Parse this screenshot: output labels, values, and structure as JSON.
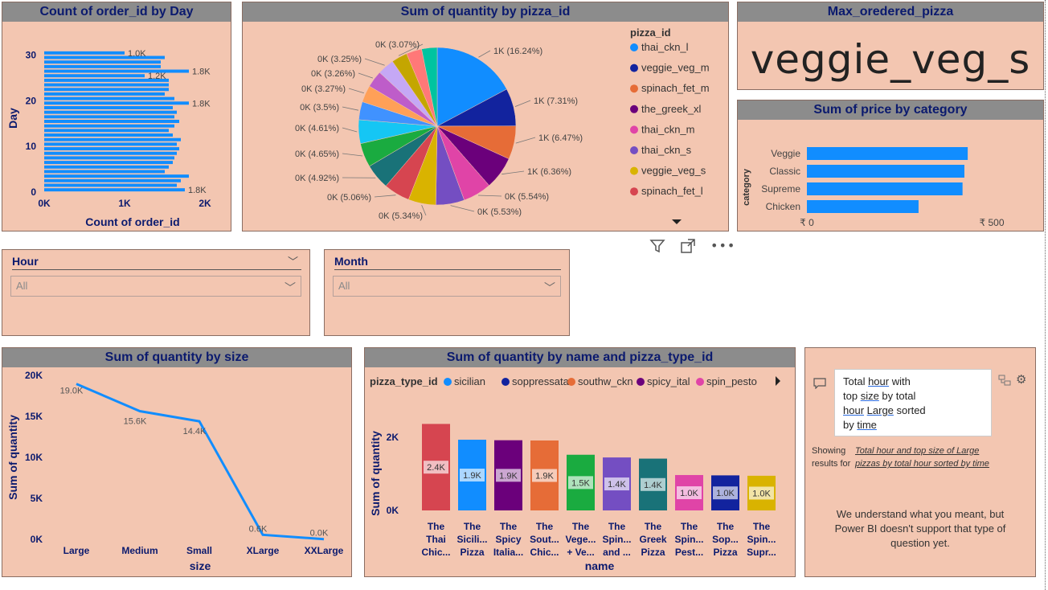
{
  "colors": {
    "panel_bg": "#f3c6b1",
    "title_bar": "#8c8c8c",
    "title_text": "#0b1a6e",
    "bar_blue": "#118dff"
  },
  "day_chart": {
    "title": "Count of order_id by Day",
    "chart_data": {
      "type": "bar",
      "orientation": "horizontal",
      "title": "Count of order_id by Day",
      "xlabel": "Count of order_id",
      "ylabel": "Day",
      "x_ticks": [
        "0K",
        "1K",
        "2K"
      ],
      "y_ticks": [
        "0",
        "10",
        "20",
        "30"
      ],
      "xlim": [
        0,
        2000
      ],
      "ylim": [
        0,
        31
      ],
      "categories": [
        1,
        2,
        3,
        4,
        5,
        6,
        7,
        8,
        9,
        10,
        11,
        12,
        13,
        14,
        15,
        16,
        17,
        18,
        19,
        20,
        21,
        22,
        23,
        24,
        25,
        26,
        27,
        28,
        29,
        30,
        31
      ],
      "values": [
        1750,
        1650,
        1700,
        1800,
        1500,
        1550,
        1600,
        1620,
        1650,
        1680,
        1650,
        1700,
        1600,
        1550,
        1620,
        1680,
        1620,
        1650,
        1600,
        1800,
        1620,
        1500,
        1550,
        1550,
        1550,
        1250,
        1800,
        1450,
        1450,
        1500,
        1000
      ],
      "data_labels": [
        {
          "day": 1,
          "text": "1.8K"
        },
        {
          "day": 20,
          "text": "1.8K"
        },
        {
          "day": 26,
          "text": "1.2K"
        },
        {
          "day": 27,
          "text": "1.8K"
        },
        {
          "day": 31,
          "text": "1.0K"
        }
      ]
    }
  },
  "pie_chart": {
    "title": "Sum of quantity by pizza_id",
    "legend_title": "pizza_id",
    "legend": [
      "thai_ckn_l",
      "veggie_veg_m",
      "spinach_fet_m",
      "the_greek_xl",
      "thai_ckn_m",
      "thai_ckn_s",
      "veggie_veg_s",
      "spinach_fet_l"
    ],
    "chart_data": {
      "type": "pie",
      "title": "Sum of quantity by pizza_id",
      "legend_placement": "right",
      "slices": [
        {
          "name": "thai_ckn_l",
          "value": 16.24,
          "label": "1K (16.24%)",
          "color": "#118dff"
        },
        {
          "name": "veggie_veg_m",
          "value": 7.31,
          "label": "1K (7.31%)",
          "color": "#12239e"
        },
        {
          "name": "spinach_fet_m",
          "value": 6.47,
          "label": "1K (6.47%)",
          "color": "#e66c37"
        },
        {
          "name": "the_greek_xl",
          "value": 6.36,
          "label": "1K (6.36%)",
          "color": "#6b007b"
        },
        {
          "name": "thai_ckn_m",
          "value": 5.54,
          "label": "0K (5.54%)",
          "color": "#e044a7"
        },
        {
          "name": "thai_ckn_s",
          "value": 5.53,
          "label": "0K (5.53%)",
          "color": "#744ec2"
        },
        {
          "name": "veggie_veg_s",
          "value": 5.34,
          "label": "0K (5.34%)",
          "color": "#d9b300"
        },
        {
          "name": "spinach_fet_l",
          "value": 5.06,
          "label": "0K (5.06%)",
          "color": "#d64550"
        },
        {
          "name": "",
          "value": 4.92,
          "label": "0K (4.92%)",
          "color": "#197278"
        },
        {
          "name": "",
          "value": 4.65,
          "label": "0K (4.65%)",
          "color": "#1aab40"
        },
        {
          "name": "",
          "value": 4.61,
          "label": "0K (4.61%)",
          "color": "#15c6f4"
        },
        {
          "name": "",
          "value": 3.5,
          "label": "0K (3.5%)",
          "color": "#4092ff"
        },
        {
          "name": "",
          "value": 3.27,
          "label": "0K (3.27%)",
          "color": "#ffa058"
        },
        {
          "name": "",
          "value": 3.26,
          "label": "0K (3.26%)",
          "color": "#be5dc9"
        },
        {
          "name": "",
          "value": 3.25,
          "label": "0K (3.25%)",
          "color": "#c5a8f5"
        },
        {
          "name": "",
          "value": 3.07,
          "label": "0K (3.07%)",
          "color": "#c4a600"
        },
        {
          "name": "",
          "value": 3.0,
          "label": "",
          "color": "#ff7878"
        },
        {
          "name": "",
          "value": 3.0,
          "label": "",
          "color": "#00c4a0"
        }
      ]
    }
  },
  "card": {
    "title": "Max_oredered_pizza",
    "value": "veggie_veg_s"
  },
  "category_chart": {
    "title": "Sum of price by category",
    "chart_data": {
      "type": "bar",
      "orientation": "horizontal",
      "title": "Sum of price by category",
      "ylabel": "category",
      "xlabel": "",
      "x_ticks": [
        "₹ 0",
        "₹ 500"
      ],
      "xlim": [
        0,
        600
      ],
      "categories": [
        "Veggie",
        "Classic",
        "Supreme",
        "Chicken"
      ],
      "values": [
        435,
        426,
        421,
        302
      ]
    }
  },
  "toolbar": {
    "filter_icon": "filter-icon",
    "focus_icon": "focus-mode-icon",
    "more_icon": "more-options-icon"
  },
  "slicer_hour": {
    "title": "Hour",
    "value": "All"
  },
  "slicer_month": {
    "title": "Month",
    "value": "All"
  },
  "size_chart": {
    "title": "Sum of quantity by size",
    "chart_data": {
      "type": "line",
      "title": "Sum of quantity by size",
      "xlabel": "size",
      "ylabel": "Sum of quantity",
      "ylim": [
        0,
        20000
      ],
      "y_ticks": [
        "0K",
        "5K",
        "10K",
        "15K",
        "20K"
      ],
      "categories": [
        "Large",
        "Medium",
        "Small",
        "XLarge",
        "XXLarge"
      ],
      "values": [
        18956,
        15635,
        14403,
        552,
        28
      ],
      "data_labels": [
        "19.0K",
        "15.6K",
        "14.4K",
        "0.6K",
        "0.0K"
      ]
    }
  },
  "name_chart": {
    "title": "Sum of quantity by name and pizza_type_id",
    "legend_title": "pizza_type_id",
    "legend": [
      {
        "name": "sicilian",
        "color": "#118dff"
      },
      {
        "name": "soppressata",
        "color": "#12239e"
      },
      {
        "name": "southw_ckn",
        "color": "#e66c37"
      },
      {
        "name": "spicy_ital",
        "color": "#6b007b"
      },
      {
        "name": "spin_pesto",
        "color": "#e044a7"
      }
    ],
    "chart_data": {
      "type": "bar",
      "title": "Sum of quantity by name and pizza_type_id",
      "xlabel": "name",
      "ylabel": "Sum of quantity",
      "ylim": [
        0,
        2600
      ],
      "y_ticks": [
        "0K",
        "2K"
      ],
      "categories": [
        [
          "The",
          "Thai",
          "Chic..."
        ],
        [
          "The",
          "Sicili...",
          "Pizza"
        ],
        [
          "The",
          "Spicy",
          "Italia..."
        ],
        [
          "The",
          "Sout...",
          "Chic..."
        ],
        [
          "The",
          "Vege...",
          "+ Ve..."
        ],
        [
          "The",
          "Spin...",
          "and ..."
        ],
        [
          "The",
          "Greek",
          "Pizza"
        ],
        [
          "The",
          "Spin...",
          "Pest..."
        ],
        [
          "The",
          "Sop...",
          "Pizza"
        ],
        [
          "The",
          "Spin...",
          "Supr..."
        ]
      ],
      "values": [
        2371,
        1938,
        1924,
        1917,
        1526,
        1452,
        1420,
        970,
        961,
        950
      ],
      "data_labels": [
        "2.4K",
        "1.9K",
        "1.9K",
        "1.9K",
        "1.5K",
        "1.4K",
        "1.4K",
        "1.0K",
        "1.0K",
        "1.0K"
      ],
      "colors": [
        "#d64550",
        "#118dff",
        "#6b007b",
        "#e66c37",
        "#1aab40",
        "#744ec2",
        "#197278",
        "#e044a7",
        "#12239e",
        "#d9b300"
      ]
    }
  },
  "qa": {
    "question_html_parts": [
      "Total ",
      "hour",
      " with",
      "top ",
      "size",
      " by total",
      "hour",
      " ",
      "Large",
      " sorted",
      "by ",
      "time"
    ],
    "showing_label": "Showing results for",
    "showing_link": "Total hour and top size of Large pizzas by total hour sorted by time",
    "message": "We understand what you meant, but Power BI doesn't support that type of question yet."
  }
}
